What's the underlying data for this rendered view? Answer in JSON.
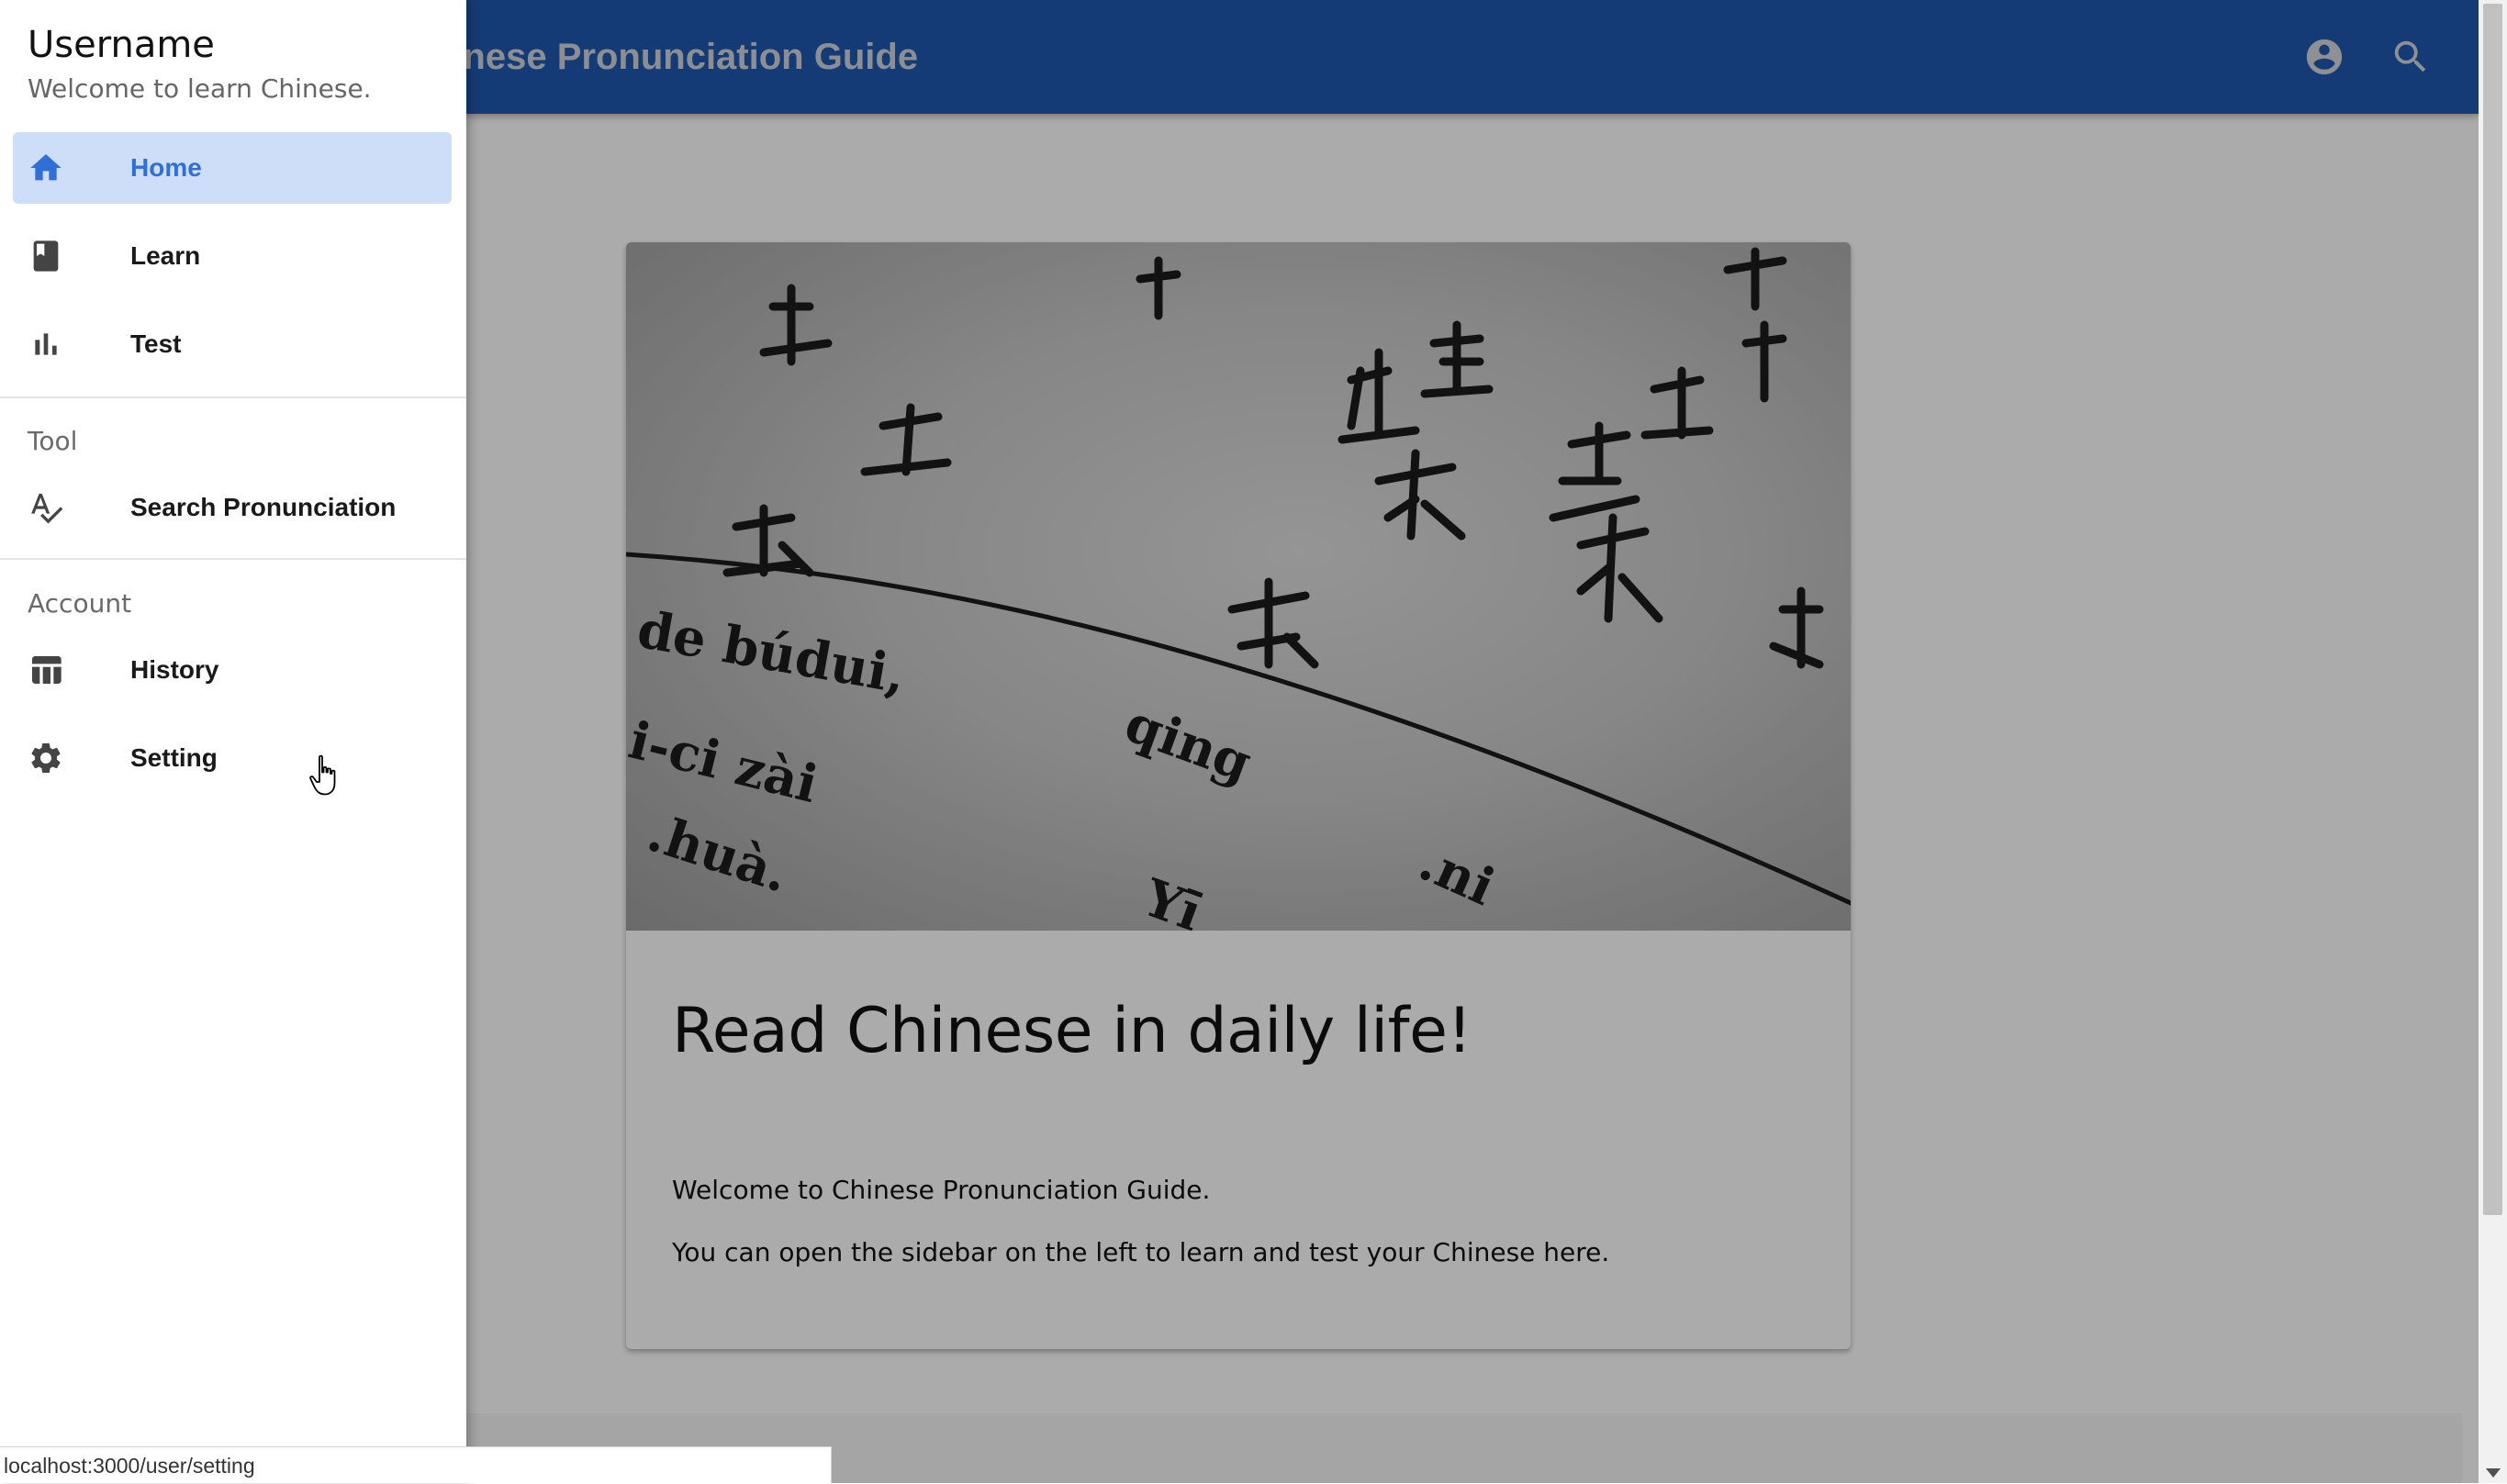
{
  "appbar": {
    "title": "Chinese Pronunciation Guide",
    "icons": [
      "account-circle-icon",
      "search-icon"
    ],
    "color": "#2059b0"
  },
  "card": {
    "image_alt": "Chinese text with pinyin",
    "title": "Read Chinese in daily life!",
    "line1": "Welcome to Chinese Pronunciation Guide.",
    "line2": "You can open the sidebar on the left to learn and test your Chinese here."
  },
  "drawer": {
    "username": "Username",
    "subtitle": "Welcome to learn Chinese.",
    "main_items": [
      {
        "label": "Home",
        "icon": "home-icon",
        "active": true
      },
      {
        "label": "Learn",
        "icon": "book-icon",
        "active": false
      },
      {
        "label": "Test",
        "icon": "bar-chart-icon",
        "active": false
      }
    ],
    "tool_header": "Tool",
    "tool_items": [
      {
        "label": "Search Pronunciation",
        "icon": "spellcheck-icon"
      }
    ],
    "account_header": "Account",
    "account_items": [
      {
        "label": "History",
        "icon": "table-icon"
      },
      {
        "label": "Setting",
        "icon": "gear-icon"
      }
    ],
    "active_color": "#2f6fd6",
    "active_bg": "#cfdef8"
  },
  "status_bar": {
    "url": "localhost:3000/user/setting"
  }
}
